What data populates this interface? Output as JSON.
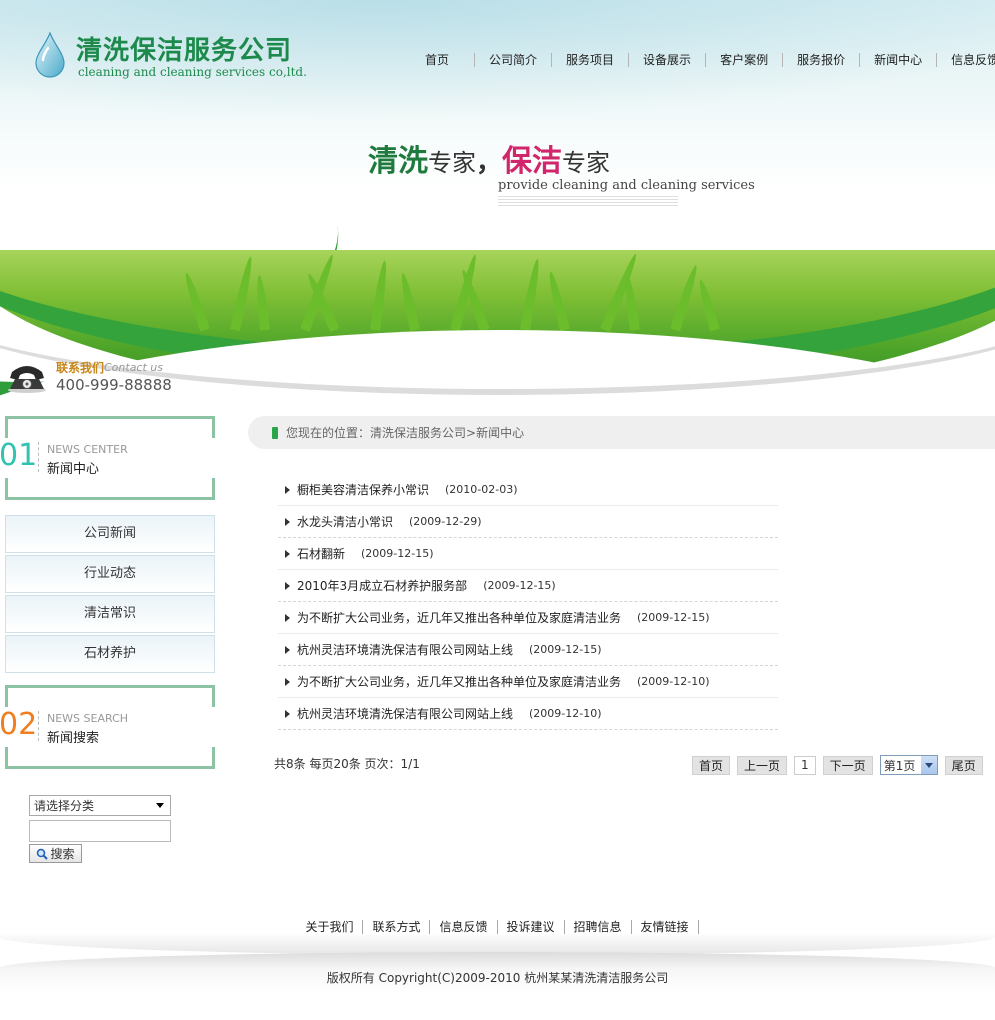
{
  "logo": {
    "cn": "清洗保洁服务公司",
    "en": "cleaning and cleaning services co,ltd."
  },
  "nav": [
    "首页",
    "公司简介",
    "服务项目",
    "设备展示",
    "客户案例",
    "服务报价",
    "新闻中心",
    "信息反馈"
  ],
  "banner": {
    "slogan_a": "清洗",
    "slogan_b": "专家",
    "slogan_comma": "，",
    "slogan_c": "保洁",
    "slogan_d": "专家",
    "slogan_en": "provide cleaning and cleaning services"
  },
  "contact": {
    "cn": "联系我们",
    "en": "Contact us",
    "tel": "400-999-88888"
  },
  "sidebar": {
    "news_center": {
      "num": "01",
      "en": "NEWS CENTER",
      "cn": "新闻中心"
    },
    "categories": [
      "公司新闻",
      "行业动态",
      "清洁常识",
      "石材养护"
    ],
    "news_search": {
      "num": "02",
      "en": "NEWS SEARCH",
      "cn": "新闻搜索"
    },
    "search": {
      "select_value": "请选择分类",
      "input_value": "",
      "button_label": "搜索"
    }
  },
  "breadcrumb": {
    "prefix": "您现在的位置：",
    "home": "清洗保洁服务公司",
    "sep": " > ",
    "current": "新闻中心"
  },
  "news": [
    {
      "title": "橱柜美容清洁保养小常识",
      "date": "(2010-02-03)"
    },
    {
      "title": "水龙头清洁小常识",
      "date": "(2009-12-29)"
    },
    {
      "title": "石材翻新",
      "date": "(2009-12-15)"
    },
    {
      "title": "2010年3月成立石材养护服务部",
      "date": "(2009-12-15)"
    },
    {
      "title": "为不断扩大公司业务，近几年又推出各种单位及家庭清洁业务",
      "date": "(2009-12-15)"
    },
    {
      "title": "杭州灵洁环境清洗保洁有限公司网站上线",
      "date": "(2009-12-15)"
    },
    {
      "title": "为不断扩大公司业务，近几年又推出各种单位及家庭清洁业务",
      "date": "(2009-12-10)"
    },
    {
      "title": "杭州灵洁环境清洗保洁有限公司网站上线",
      "date": "(2009-12-10)"
    }
  ],
  "pagination": {
    "info": "共8条  每页20条  页次：1/1",
    "first": "首页",
    "prev": "上一页",
    "current_num": "1",
    "next": "下一页",
    "select_value": "第1页",
    "last": "尾页"
  },
  "footer": {
    "links": [
      "关于我们",
      "联系方式",
      "信息反馈",
      "投诉建议",
      "招聘信息",
      "友情链接"
    ],
    "copyright": "版权所有  Copyright(C)2009-2010 杭州某某清洗清洁服务公司"
  },
  "colors": {
    "brand_green": "#1d8a4c",
    "accent_pink": "#d1266b",
    "num_teal": "#2fc3b0",
    "num_orange": "#f07e1e",
    "bracket": "#8bc3a4"
  },
  "icons": {
    "logo": "water-drop-icon",
    "contact": "telephone-icon",
    "breadcrumb": "location-marker-icon",
    "search": "magnifier-icon"
  }
}
